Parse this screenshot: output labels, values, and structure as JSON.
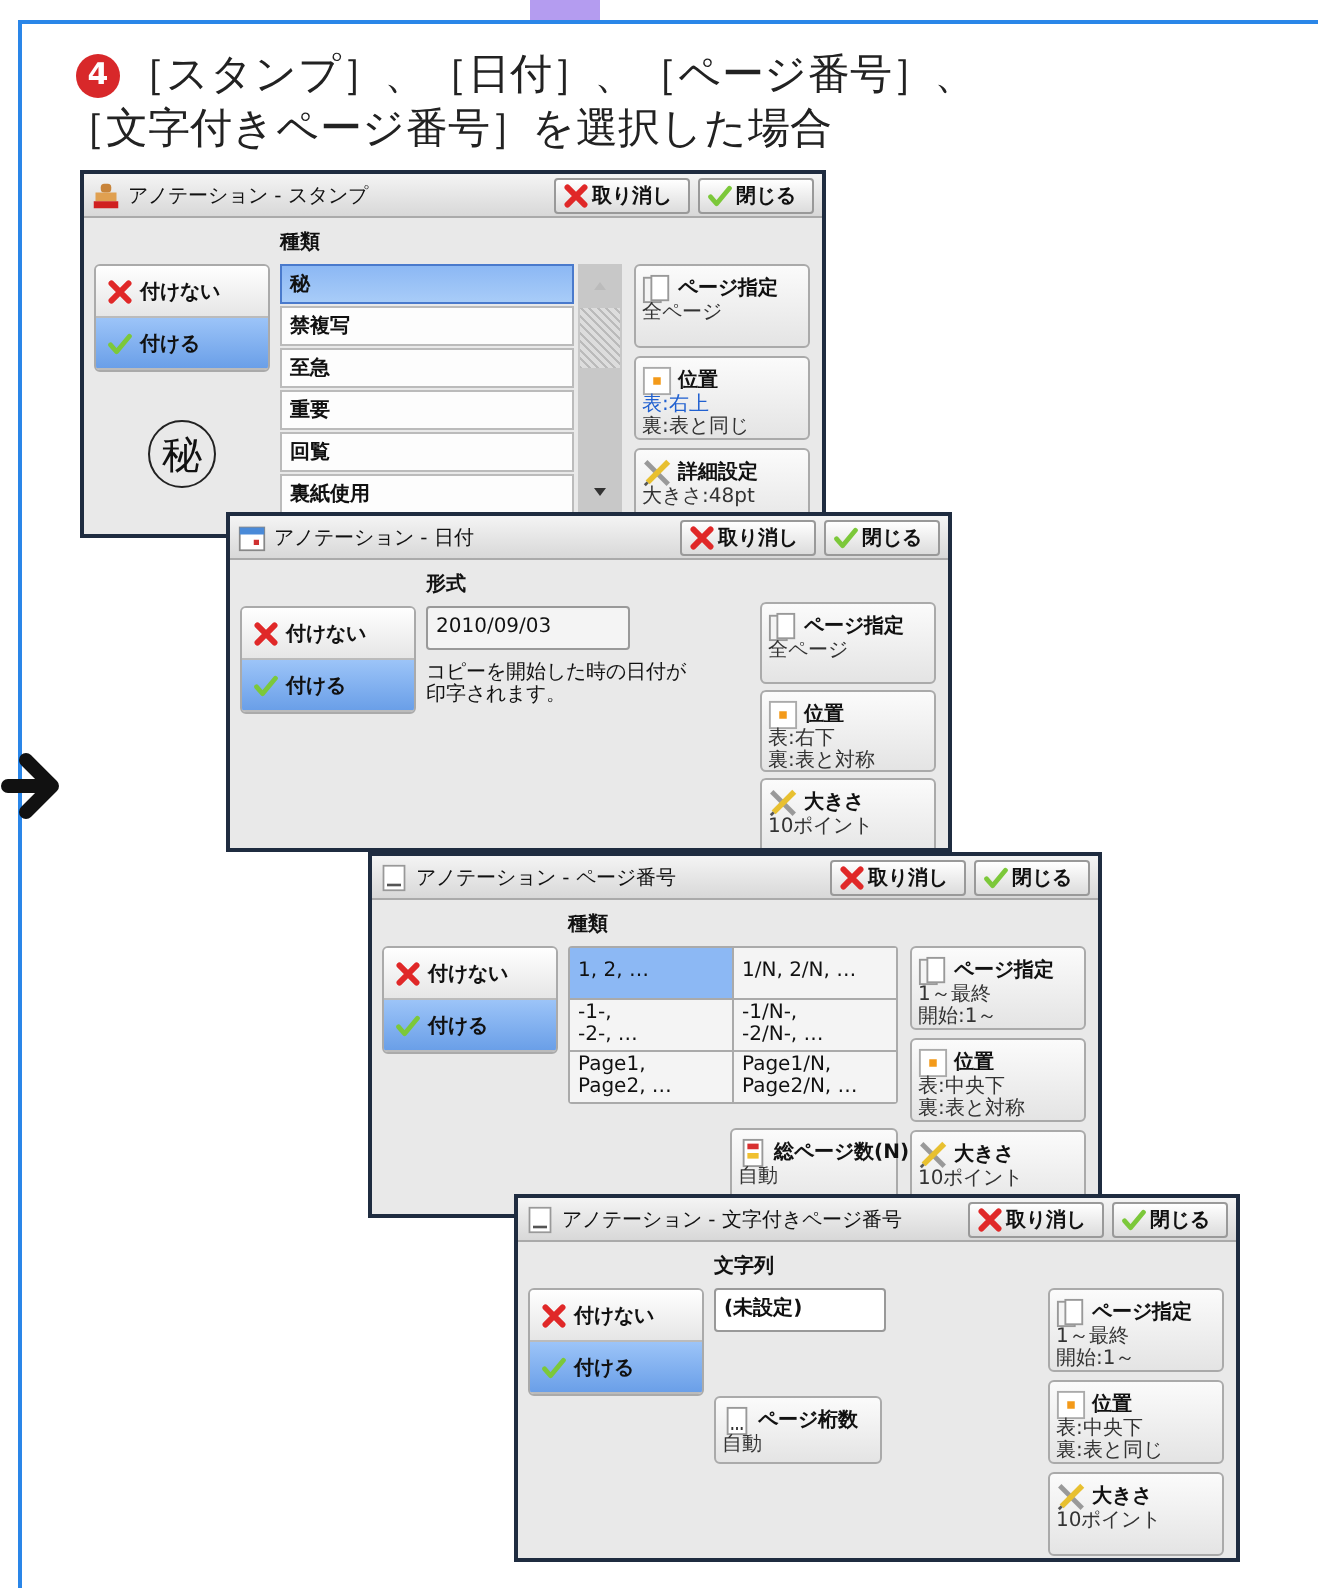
{
  "heading": {
    "number": "4",
    "lines": [
      "［スタンプ］、［日付］、［ページ番号］、",
      "［文字付きページ番号］を選択した場合"
    ]
  },
  "windows": [
    {
      "kind": "stamp",
      "title": "アノテーション - スタンプ",
      "cancel": "取り消し",
      "close": "閉じる",
      "section_label": "種類",
      "options": [
        {
          "kind": "off",
          "label": "付けない",
          "selected": false
        },
        {
          "kind": "on",
          "label": "付ける",
          "selected": true
        }
      ],
      "list": [
        {
          "label": "秘",
          "selected": true
        },
        {
          "label": "禁複写",
          "selected": false
        },
        {
          "label": "至急",
          "selected": false
        },
        {
          "label": "重要",
          "selected": false
        },
        {
          "label": "回覧",
          "selected": false
        },
        {
          "label": "裏紙使用",
          "selected": false
        }
      ],
      "preview": "秘",
      "side_buttons": [
        {
          "kind": "pages",
          "label": "ページ指定",
          "details": [
            {
              "text": "全ページ",
              "highlight": false
            }
          ]
        },
        {
          "kind": "position",
          "label": "位置",
          "details": [
            {
              "text": "表:右上",
              "highlight": true
            },
            {
              "text": "裏:表と同じ",
              "highlight": false
            }
          ]
        },
        {
          "kind": "tools",
          "label": "詳細設定",
          "details": [
            {
              "text": "大きさ:48pt",
              "highlight": false
            }
          ]
        }
      ]
    },
    {
      "kind": "date",
      "title": "アノテーション - 日付",
      "cancel": "取り消し",
      "close": "閉じる",
      "section_label": "形式",
      "options": [
        {
          "kind": "off",
          "label": "付けない",
          "selected": false
        },
        {
          "kind": "on",
          "label": "付ける",
          "selected": true
        }
      ],
      "field": {
        "value": "2010/09/03"
      },
      "note": "コピーを開始した時の日付が印字されます。",
      "side_buttons": [
        {
          "kind": "pages",
          "label": "ページ指定",
          "details": [
            {
              "text": "全ページ",
              "highlight": false
            }
          ]
        },
        {
          "kind": "position",
          "label": "位置",
          "details": [
            {
              "text": "表:右下",
              "highlight": false
            },
            {
              "text": "裏:表と対称",
              "highlight": false
            }
          ]
        },
        {
          "kind": "tools",
          "label": "大きさ",
          "details": [
            {
              "text": "10ポイント",
              "highlight": false
            }
          ]
        }
      ]
    },
    {
      "kind": "page_number",
      "title": "アノテーション - ページ番号",
      "cancel": "取り消し",
      "close": "閉じる",
      "section_label": "種類",
      "options": [
        {
          "kind": "off",
          "label": "付けない",
          "selected": false
        },
        {
          "kind": "on",
          "label": "付ける",
          "selected": true
        }
      ],
      "grid": [
        {
          "label": "1, 2, …",
          "selected": true
        },
        {
          "label": "1/N, 2/N, …",
          "selected": false
        },
        {
          "label": "-1-,\n-2-, …",
          "selected": false
        },
        {
          "label": "-1/N-,\n-2/N-, …",
          "selected": false
        },
        {
          "label": "Page1,\nPage2, …",
          "selected": false
        },
        {
          "label": "Page1/N,\nPage2/N, …",
          "selected": false
        }
      ],
      "extra_button": {
        "kind": "total",
        "label": "総ページ数(N)",
        "details": [
          {
            "text": "自動",
            "highlight": false
          }
        ]
      },
      "side_buttons": [
        {
          "kind": "pages",
          "label": "ページ指定",
          "details": [
            {
              "text": "1～最終",
              "highlight": false
            },
            {
              "text": "開始:1～",
              "highlight": false
            }
          ]
        },
        {
          "kind": "position",
          "label": "位置",
          "details": [
            {
              "text": "表:中央下",
              "highlight": false
            },
            {
              "text": "裏:表と対称",
              "highlight": false
            }
          ]
        },
        {
          "kind": "tools",
          "label": "大きさ",
          "details": [
            {
              "text": "10ポイント",
              "highlight": false
            }
          ]
        }
      ]
    },
    {
      "kind": "text_page_number",
      "title": "アノテーション - 文字付きページ番号",
      "cancel": "取り消し",
      "close": "閉じる",
      "section_label": "文字列",
      "options": [
        {
          "kind": "off",
          "label": "付けない",
          "selected": false
        },
        {
          "kind": "on",
          "label": "付ける",
          "selected": true
        }
      ],
      "field": {
        "value": "(未設定)"
      },
      "extra_button": {
        "kind": "digits",
        "label": "ページ桁数",
        "details": [
          {
            "text": "自動",
            "highlight": false
          }
        ]
      },
      "side_buttons": [
        {
          "kind": "pages",
          "label": "ページ指定",
          "details": [
            {
              "text": "1～最終",
              "highlight": false
            },
            {
              "text": "開始:1～",
              "highlight": false
            }
          ]
        },
        {
          "kind": "position",
          "label": "位置",
          "details": [
            {
              "text": "表:中央下",
              "highlight": false
            },
            {
              "text": "裏:表と同じ",
              "highlight": false
            }
          ]
        },
        {
          "kind": "tools",
          "label": "大きさ",
          "details": [
            {
              "text": "10ポイント",
              "highlight": false
            }
          ]
        }
      ]
    }
  ]
}
